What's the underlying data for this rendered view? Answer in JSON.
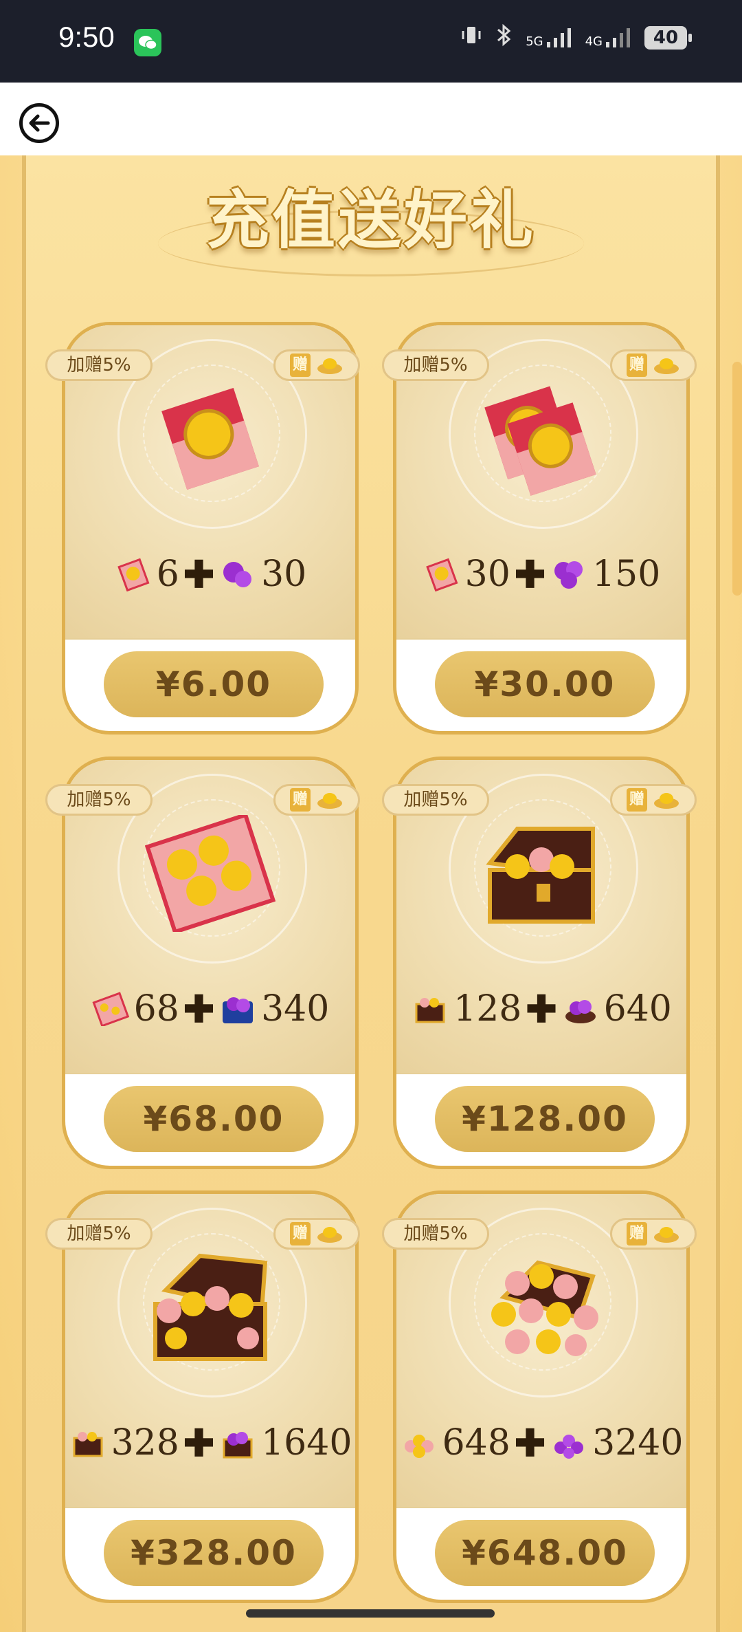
{
  "status_bar": {
    "time": "9:50",
    "network_1": "5G",
    "network_2": "4G",
    "battery": "40"
  },
  "page": {
    "title": "充值送好礼"
  },
  "packages": [
    {
      "bonus_label": "加赠5%",
      "gift_label": "赠",
      "reward_primary": "6",
      "reward_secondary": "30",
      "price": "¥6.00",
      "icon": "single-red-packet-icon"
    },
    {
      "bonus_label": "加赠5%",
      "gift_label": "赠",
      "reward_primary": "30",
      "reward_secondary": "150",
      "price": "¥30.00",
      "icon": "double-red-packet-icon"
    },
    {
      "bonus_label": "加赠5%",
      "gift_label": "赠",
      "reward_primary": "68",
      "reward_secondary": "340",
      "price": "¥68.00",
      "icon": "red-packet-stack-icon"
    },
    {
      "bonus_label": "加赠5%",
      "gift_label": "赠",
      "reward_primary": "128",
      "reward_secondary": "640",
      "price": "¥128.00",
      "icon": "treasure-chest-icon"
    },
    {
      "bonus_label": "加赠5%",
      "gift_label": "赠",
      "reward_primary": "328",
      "reward_secondary": "1640",
      "price": "¥328.00",
      "icon": "big-treasure-chest-icon"
    },
    {
      "bonus_label": "加赠5%",
      "gift_label": "赠",
      "reward_primary": "648",
      "reward_secondary": "3240",
      "price": "¥648.00",
      "icon": "huge-treasure-chest-icon"
    }
  ],
  "colors": {
    "accent_gold": "#dfb04f",
    "price_text": "#6b4a1a",
    "red_packet": "#d9334a",
    "coin": "#f5c518",
    "purple_gem": "#9b2fd0"
  }
}
